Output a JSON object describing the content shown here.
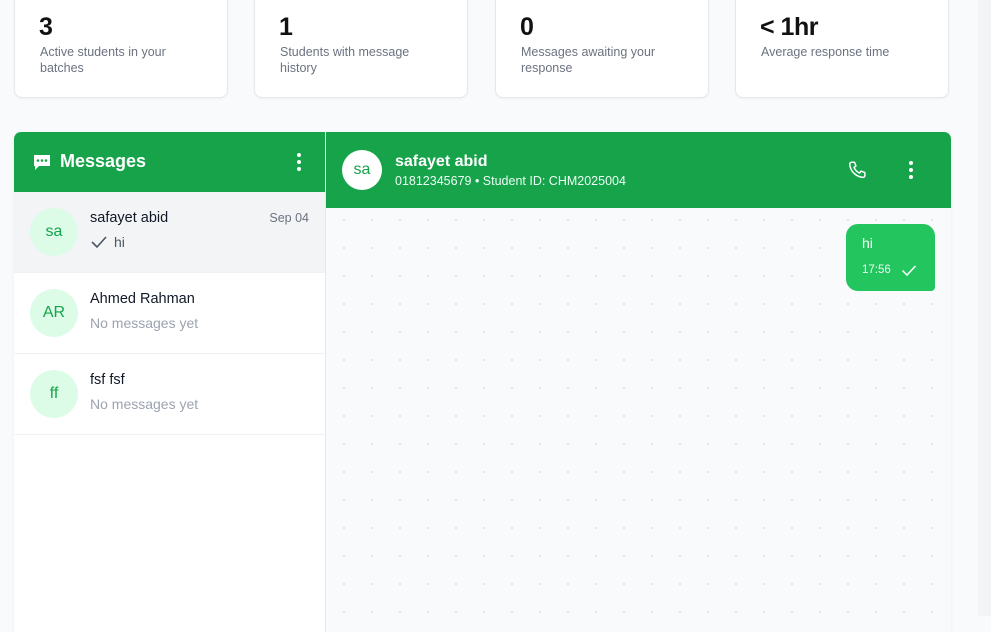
{
  "stats": [
    {
      "value": "3",
      "label": "Active students in your batches",
      "icon": "users-icon"
    },
    {
      "value": "1",
      "label": "Students with message history",
      "icon": "chat-icon"
    },
    {
      "value": "0",
      "label": "Messages awaiting your response",
      "icon": "alert-icon"
    },
    {
      "value": "< 1hr",
      "label": "Average response time",
      "icon": "clock-icon"
    }
  ],
  "sidebar": {
    "title": "Messages",
    "conversations": [
      {
        "initials": "sa",
        "name": "safayet abid",
        "date": "Sep 04",
        "preview": "hi",
        "read": true,
        "active": true
      },
      {
        "initials": "AR",
        "name": "Ahmed Rahman",
        "date": "",
        "preview": "No messages yet",
        "read": false,
        "active": false
      },
      {
        "initials": "ff",
        "name": "fsf fsf",
        "date": "",
        "preview": "No messages yet",
        "read": false,
        "active": false
      }
    ]
  },
  "chat": {
    "initials": "sa",
    "name": "safayet abid",
    "subtitle": "01812345679 • Student ID: CHM2025004",
    "messages": [
      {
        "text": "hi",
        "time": "17:56",
        "status": "sent"
      }
    ]
  },
  "colors": {
    "brand": "#16a34a",
    "bubble": "#22c55e",
    "avatar_bg": "#dcfce7"
  }
}
